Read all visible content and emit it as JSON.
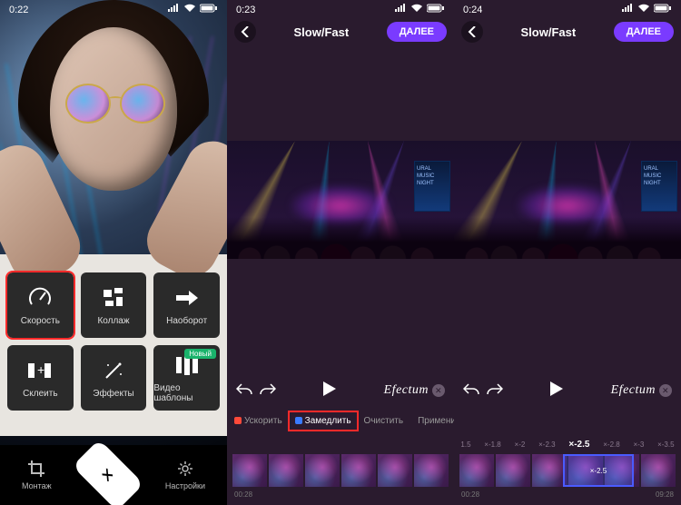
{
  "pane1": {
    "status_time": "0:22",
    "tiles": [
      {
        "key": "speed",
        "label": "Скорость",
        "selected": true
      },
      {
        "key": "collage",
        "label": "Коллаж",
        "selected": false
      },
      {
        "key": "reverse",
        "label": "Наоборот",
        "selected": false
      },
      {
        "key": "merge",
        "label": "Склеить",
        "selected": false
      },
      {
        "key": "effects",
        "label": "Эффекты",
        "selected": false
      },
      {
        "key": "templates",
        "label": "Видео шаблоны",
        "selected": false,
        "badge": "Новый"
      }
    ],
    "nav": {
      "montage": "Монтаж",
      "settings": "Настройки"
    }
  },
  "pane2": {
    "status_time": "0:23",
    "title": "Slow/Fast",
    "next": "ДАЛЕЕ",
    "brand": "Efectum",
    "tabs": {
      "speedup": "Ускорить",
      "slowdown": "Замедлить",
      "clear": "Очистить",
      "apply": "Применить"
    },
    "tl_start": "00:28"
  },
  "pane3": {
    "status_time": "0:24",
    "title": "Slow/Fast",
    "next": "ДАЛЕЕ",
    "brand": "Efectum",
    "scale": [
      "1.5",
      "×-1.8",
      "×-2",
      "×-2.3",
      "×-2.5",
      "×-2.8",
      "×-3",
      "×-3.5"
    ],
    "scale_current": "×-2.5",
    "marker_label": "×-2.5",
    "tl_start": "00:28",
    "tl_end": "09:28",
    "poster_text": "URAL MUSIC NIGHT"
  }
}
